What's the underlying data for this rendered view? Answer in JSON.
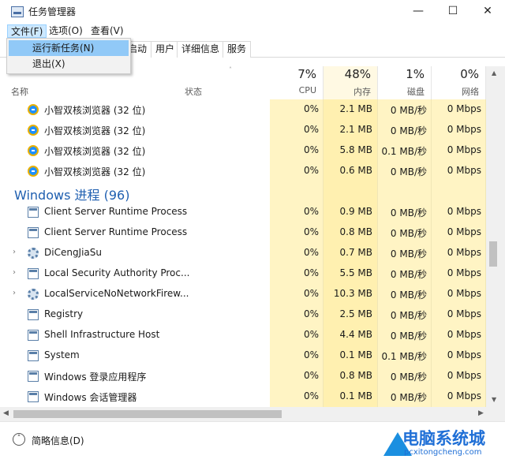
{
  "window": {
    "title": "任务管理器",
    "controls": {
      "minimize": "—",
      "maximize": "☐",
      "close": "✕"
    }
  },
  "menu": {
    "items": [
      {
        "label": "文件(F)"
      },
      {
        "label": "选项(O)"
      },
      {
        "label": "查看(V)"
      }
    ],
    "file_dropdown": [
      {
        "label": "运行新任务(N)"
      },
      {
        "label": "退出(X)"
      }
    ]
  },
  "tabs": [
    {
      "label": "启动"
    },
    {
      "label": "用户"
    },
    {
      "label": "详细信息"
    },
    {
      "label": "服务"
    }
  ],
  "columns": {
    "name": "名称",
    "status": "状态",
    "cpu": {
      "pct": "7%",
      "label": "CPU"
    },
    "memory": {
      "pct": "48%",
      "label": "内存"
    },
    "disk": {
      "pct": "1%",
      "label": "磁盘"
    },
    "network": {
      "pct": "0%",
      "label": "网络"
    }
  },
  "rows": [
    {
      "type": "process",
      "icon": "browser-icon",
      "name": "小智双核浏览器 (32 位)",
      "cpu": "0%",
      "mem": "2.1 MB",
      "disk": "0 MB/秒",
      "net": "0 Mbps"
    },
    {
      "type": "process",
      "icon": "browser-icon",
      "name": "小智双核浏览器 (32 位)",
      "cpu": "0%",
      "mem": "2.1 MB",
      "disk": "0 MB/秒",
      "net": "0 Mbps"
    },
    {
      "type": "process",
      "icon": "browser-icon",
      "name": "小智双核浏览器 (32 位)",
      "cpu": "0%",
      "mem": "5.8 MB",
      "disk": "0.1 MB/秒",
      "net": "0 Mbps"
    },
    {
      "type": "process",
      "icon": "browser-icon",
      "name": "小智双核浏览器 (32 位)",
      "cpu": "0%",
      "mem": "0.6 MB",
      "disk": "0 MB/秒",
      "net": "0 Mbps"
    },
    {
      "type": "group",
      "name": "Windows 进程 (96)"
    },
    {
      "type": "process",
      "icon": "window-icon",
      "name": "Client Server Runtime Process",
      "cpu": "0%",
      "mem": "0.9 MB",
      "disk": "0 MB/秒",
      "net": "0 Mbps"
    },
    {
      "type": "process",
      "icon": "window-icon",
      "name": "Client Server Runtime Process",
      "cpu": "0%",
      "mem": "0.8 MB",
      "disk": "0 MB/秒",
      "net": "0 Mbps"
    },
    {
      "type": "process",
      "icon": "gear-icon",
      "expand": "›",
      "name": "DiCengJiaSu",
      "cpu": "0%",
      "mem": "0.7 MB",
      "disk": "0 MB/秒",
      "net": "0 Mbps"
    },
    {
      "type": "process",
      "icon": "window-icon",
      "expand": "›",
      "name": "Local Security Authority Proc...",
      "cpu": "0%",
      "mem": "5.5 MB",
      "disk": "0 MB/秒",
      "net": "0 Mbps"
    },
    {
      "type": "process",
      "icon": "gear-icon",
      "expand": "›",
      "name": "LocalServiceNoNetworkFirew...",
      "cpu": "0%",
      "mem": "10.3 MB",
      "disk": "0 MB/秒",
      "net": "0 Mbps"
    },
    {
      "type": "process",
      "icon": "window-icon",
      "name": "Registry",
      "cpu": "0%",
      "mem": "2.5 MB",
      "disk": "0 MB/秒",
      "net": "0 Mbps"
    },
    {
      "type": "process",
      "icon": "window-icon",
      "name": "Shell Infrastructure Host",
      "cpu": "0%",
      "mem": "4.4 MB",
      "disk": "0 MB/秒",
      "net": "0 Mbps"
    },
    {
      "type": "process",
      "icon": "window-icon",
      "name": "System",
      "cpu": "0%",
      "mem": "0.1 MB",
      "disk": "0.1 MB/秒",
      "net": "0 Mbps"
    },
    {
      "type": "process",
      "icon": "window-icon",
      "name": "Windows 登录应用程序",
      "cpu": "0%",
      "mem": "0.8 MB",
      "disk": "0 MB/秒",
      "net": "0 Mbps"
    },
    {
      "type": "process",
      "icon": "window-icon",
      "name": "Windows 会话管理器",
      "cpu": "0%",
      "mem": "0.1 MB",
      "disk": "0 MB/秒",
      "net": "0 Mbps"
    }
  ],
  "footer": {
    "label": "简略信息(D)"
  },
  "watermark": {
    "title": "电脑系统城",
    "url": "pcxitongcheng.com"
  },
  "colors": {
    "accent": "#1f5fb0",
    "highlight": "#fff4c4",
    "menu_hover": "#91c9f7"
  }
}
